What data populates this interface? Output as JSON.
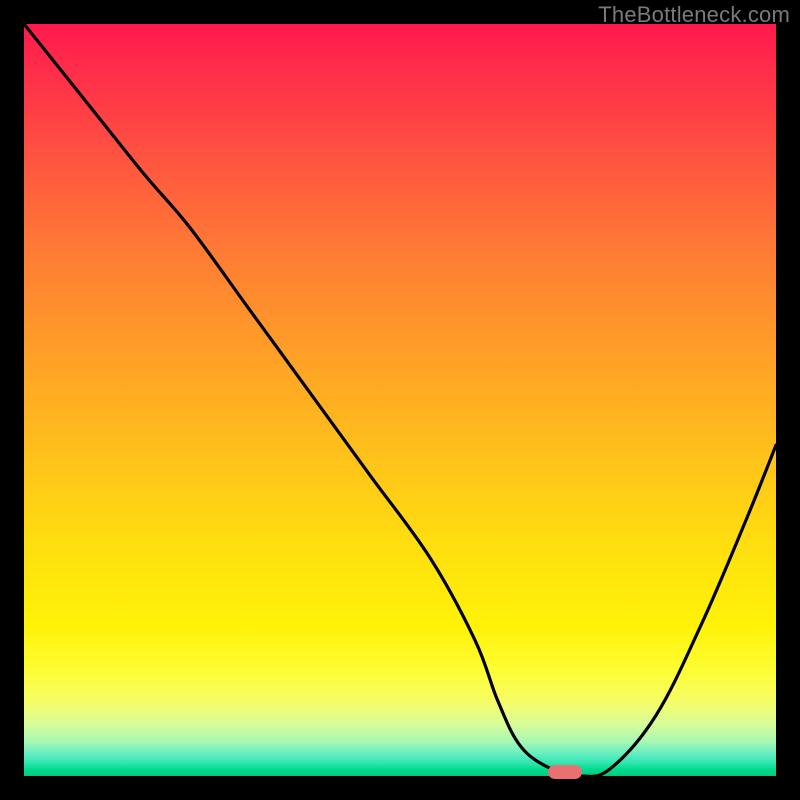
{
  "watermark": "TheBottleneck.com",
  "chart_data": {
    "type": "line",
    "title": "",
    "xlabel": "",
    "ylabel": "",
    "xlim": [
      0,
      100
    ],
    "ylim": [
      0,
      100
    ],
    "grid": false,
    "legend": false,
    "background_gradient": {
      "top": "#ff1a4d",
      "mid": "#ffd400",
      "bottom": "#00c97a"
    },
    "series": [
      {
        "name": "bottleneck-curve",
        "color": "#000000",
        "x": [
          0,
          8,
          16,
          22,
          30,
          38,
          46,
          54,
          60,
          63,
          66,
          70,
          74,
          78,
          84,
          90,
          96,
          100
        ],
        "y": [
          100,
          90,
          80,
          73,
          62,
          51,
          40,
          29,
          18,
          10,
          4,
          1,
          0,
          1,
          8,
          20,
          34,
          44
        ]
      }
    ],
    "marker": {
      "name": "optimal-point",
      "x": 72,
      "y": 0.5,
      "color": "#e87070"
    }
  }
}
